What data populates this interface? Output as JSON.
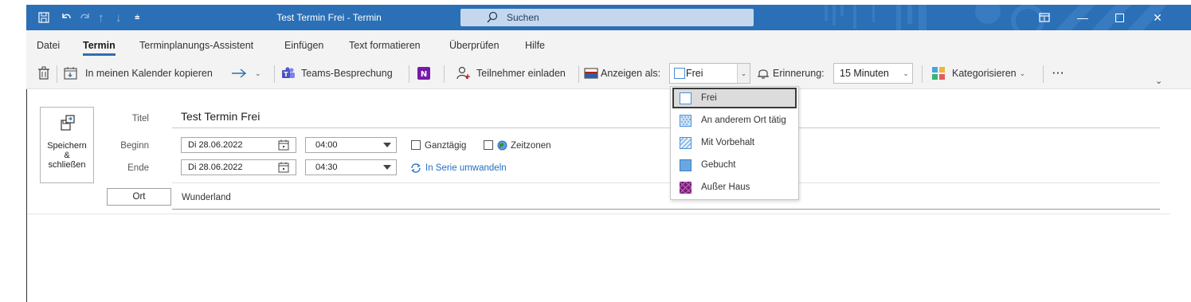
{
  "window": {
    "title": "Test Termin Frei  -  Termin",
    "search_label": "Suchen"
  },
  "menu": {
    "items": [
      "Datei",
      "Termin",
      "Terminplanungs-Assistent",
      "Einfügen",
      "Text formatieren",
      "Überprüfen",
      "Hilfe"
    ],
    "active": "Termin"
  },
  "ribbon": {
    "copy_to_calendar": "In meinen Kalender kopieren",
    "teams_meeting": "Teams-Besprechung",
    "invite_attendees": "Teilnehmer einladen",
    "show_as_label": "Anzeigen als:",
    "show_as_value": "Frei",
    "reminder_label": "Erinnerung:",
    "reminder_value": "15 Minuten",
    "categorize": "Kategorisieren",
    "more": "···"
  },
  "form": {
    "save_close": "Speichern\n&\nschließen",
    "title_label": "Titel",
    "title_value": "Test Termin Frei",
    "start_label": "Beginn",
    "start_date": "Di 28.06.2022",
    "start_time": "04:00",
    "end_label": "Ende",
    "end_date": "Di 28.06.2022",
    "end_time": "04:30",
    "all_day_label": "Ganztägig",
    "time_zones_label": "Zeitzonen",
    "recurrence_label": "In Serie umwandeln",
    "location_button": "Ort",
    "location_value": "Wunderland"
  },
  "show_as_dropdown": {
    "options": [
      "Frei",
      "An anderem Ort tätig",
      "Mit Vorbehalt",
      "Gebucht",
      "Außer Haus"
    ],
    "selected": "Frei"
  },
  "colors": {
    "title_bar": "#2b6fb6",
    "accent": "#2b6fb6",
    "busy": "#6aa6e0",
    "out_of_office": "#7a1c7a",
    "link": "#1f6fc5"
  }
}
